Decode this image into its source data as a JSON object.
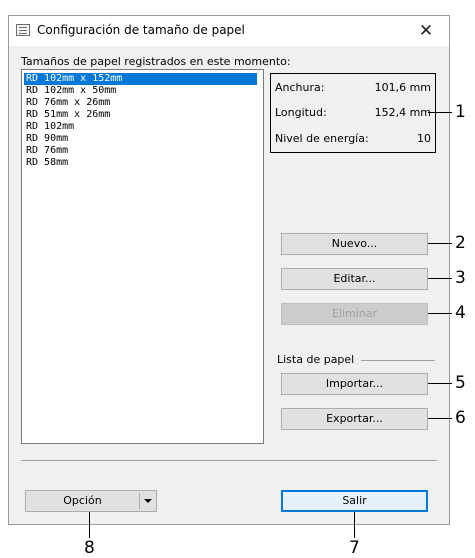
{
  "window": {
    "title": "Configuración de tamaño de papel",
    "close_glyph": "✕"
  },
  "list": {
    "label": "Tamaños de papel registrados en este momento:",
    "items": [
      "RD 102mm x 152mm",
      "RD 102mm x 50mm",
      "RD 76mm x 26mm",
      "RD 51mm x 26mm",
      "RD 102mm",
      "RD 90mm",
      "RD 76mm",
      "RD 58mm"
    ],
    "selected_index": 0
  },
  "info": {
    "width_label": "Anchura:",
    "width_value": "101,6 mm",
    "length_label": "Longitud:",
    "length_value": "152,4 mm",
    "energy_label": "Nivel de energía:",
    "energy_value": "10"
  },
  "buttons": {
    "new": "Nuevo...",
    "edit": "Editar...",
    "delete": "Eliminar",
    "paper_list_label": "Lista de papel",
    "import": "Importar...",
    "export": "Exportar...",
    "option": "Opción",
    "exit": "Salir"
  },
  "callouts": [
    "1",
    "2",
    "3",
    "4",
    "5",
    "6",
    "7",
    "8"
  ],
  "colors": {
    "accent": "#0078d7",
    "dialog_bg": "#f0f0f0"
  }
}
